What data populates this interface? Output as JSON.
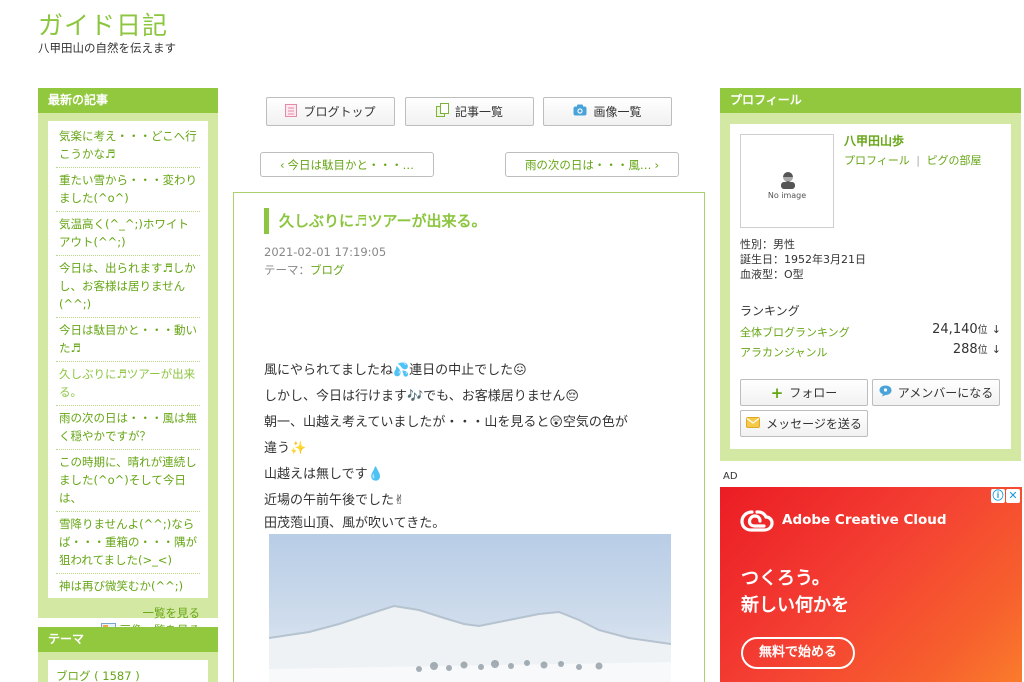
{
  "site": {
    "title": "ガイド日記",
    "subtitle": "八甲田山の自然を伝えます"
  },
  "left_sidebar": {
    "recent_title": "最新の記事",
    "recent_items": [
      "気楽に考え・・・どこへ行こうかな♬",
      "重たい雪から・・・変わりました(^o^)",
      "気温高く(^_^;)ホワイトアウト(^^;)",
      "今日は、出られます♬しかし、お客様は居りません(^^;)",
      "今日は駄目かと・・・動いた♬",
      "久しぶりに♬ツアーが出来る。",
      "雨の次の日は・・・風は無く穏やかですが？",
      "この時期に、晴れが連続しました(^o^)そして今日は、",
      "雪降りませんよ(^^;)ならば・・・重箱の・・・隅が狙われてました(>_<)",
      "神は再び微笑むか(^^;)"
    ],
    "see_all": "一覧を見る",
    "see_images": "画像一覧を見る",
    "theme_title": "テーマ",
    "theme_item": "ブログ ( 1587 )"
  },
  "nav": {
    "blog_top": "ブログトップ",
    "article_list": "記事一覧",
    "image_list": "画像一覧"
  },
  "pager": {
    "prev": "今日は駄目かと・・・…",
    "next": "雨の次の日は・・・風…"
  },
  "article": {
    "title": "久しぶりに♬ツアーが出来る。",
    "date": "2021-02-01 17:19:05",
    "theme_label": "テーマ：",
    "theme_value": "ブログ",
    "lines": [
      "風にやられてましたね💦連日の中止でした😖",
      "しかし、今日は行けます🎶でも、お客様居りません😔",
      "朝一、山越え考えていましたが・・・山を見ると😲空気の色が",
      "違う✨",
      "山越えは無しです💧",
      "近場の午前午後でした✌",
      "田茂萢山頂、風が吹いてきた。"
    ]
  },
  "profile": {
    "title": "プロフィール",
    "name": "八甲田山歩",
    "profile_link": "プロフィール",
    "separator": "|",
    "room_link": "ピグの部屋",
    "no_image": "No image",
    "gender": "性別：男性",
    "birthday": "誕生日：1952年3月21日",
    "blood": "血液型：O型",
    "ranking_title": "ランキング",
    "rankings": [
      {
        "label": "全体ブログランキング",
        "value": "24,140",
        "unit": "位",
        "arrow": "↓"
      },
      {
        "label": "アラカンジャンル",
        "value": "288",
        "unit": "位",
        "arrow": "↓"
      }
    ],
    "follow": "フォロー",
    "amember": "アメンバーになる",
    "message": "メッセージを送る"
  },
  "ad": {
    "label": "AD",
    "brand": "Adobe Creative Cloud",
    "headline1": "つくろう。",
    "headline2": "新しい何かを",
    "cta": "無料で始める"
  },
  "colors": {
    "accent": "#8cc63f",
    "accent_dark": "#66a615",
    "sidebar_bg": "#d3e9a3",
    "ad_red": "#eb1c24"
  }
}
